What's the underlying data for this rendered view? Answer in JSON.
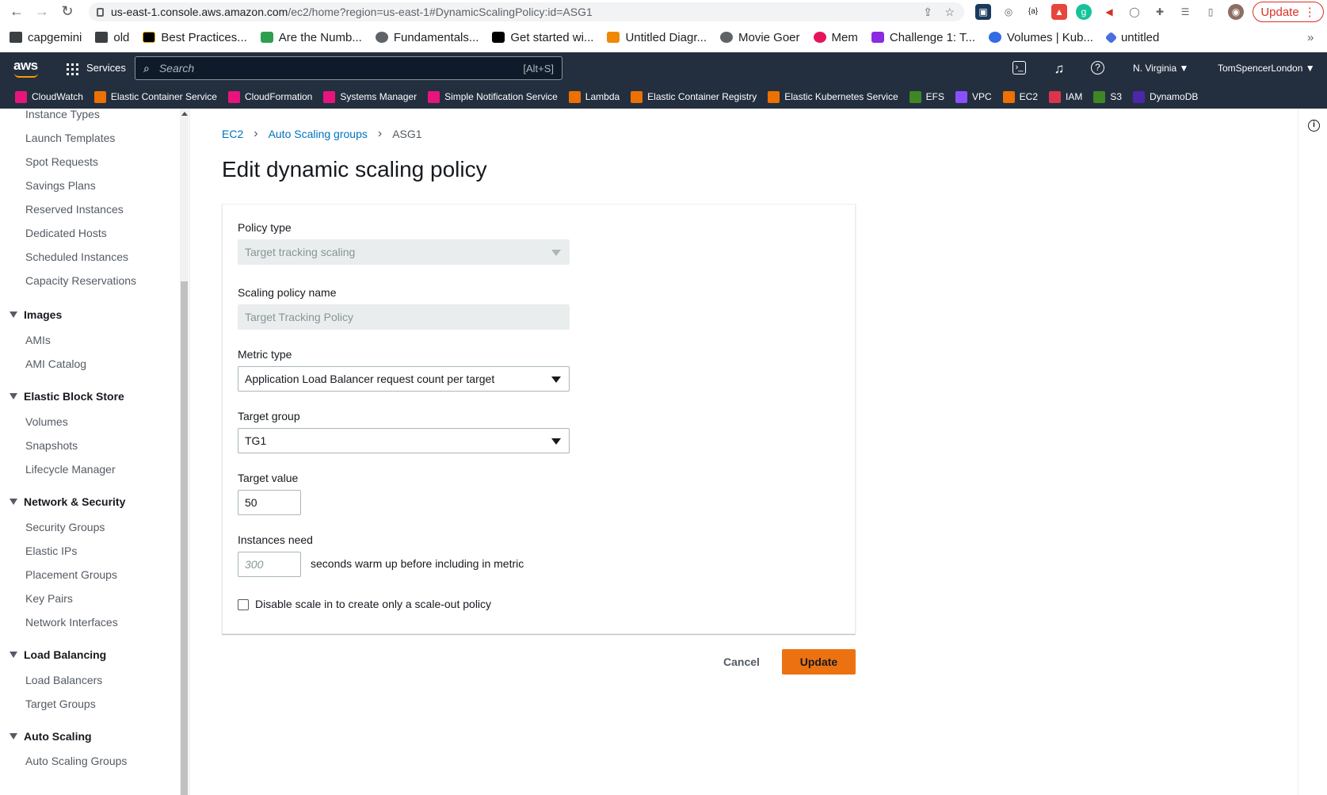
{
  "browser": {
    "url_host": "us-east-1.console.aws.amazon.com",
    "url_path": "/ec2/home?region=us-east-1#DynamicScalingPolicy:id=ASG1",
    "update_label": "Update"
  },
  "bookmarks": [
    "capgemini",
    "old",
    "Best Practices...",
    "Are the Numb...",
    "Fundamentals...",
    "Get started wi...",
    "Untitled Diagr...",
    "Movie Goer",
    "Mem",
    "Challenge 1: T...",
    "Volumes | Kub...",
    "untitled"
  ],
  "aws_nav": {
    "services_label": "Services",
    "search_placeholder": "Search",
    "search_shortcut": "[Alt+S]",
    "region": "N. Virginia",
    "user": "TomSpencerLondon"
  },
  "favorites": [
    "CloudWatch",
    "Elastic Container Service",
    "CloudFormation",
    "Systems Manager",
    "Simple Notification Service",
    "Lambda",
    "Elastic Container Registry",
    "Elastic Kubernetes Service",
    "EFS",
    "VPC",
    "EC2",
    "IAM",
    "S3",
    "DynamoDB"
  ],
  "sidebar": {
    "instances_items": [
      "Instance Types",
      "Launch Templates",
      "Spot Requests",
      "Savings Plans",
      "Reserved Instances",
      "Dedicated Hosts",
      "Scheduled Instances",
      "Capacity Reservations"
    ],
    "images_title": "Images",
    "images_items": [
      "AMIs",
      "AMI Catalog"
    ],
    "ebs_title": "Elastic Block Store",
    "ebs_items": [
      "Volumes",
      "Snapshots",
      "Lifecycle Manager"
    ],
    "network_title": "Network & Security",
    "network_items": [
      "Security Groups",
      "Elastic IPs",
      "Placement Groups",
      "Key Pairs",
      "Network Interfaces"
    ],
    "lb_title": "Load Balancing",
    "lb_items": [
      "Load Balancers",
      "Target Groups"
    ],
    "as_title": "Auto Scaling",
    "as_items": [
      "Auto Scaling Groups"
    ]
  },
  "breadcrumb": {
    "ec2": "EC2",
    "asg": "Auto Scaling groups",
    "current": "ASG1"
  },
  "page_title": "Edit dynamic scaling policy",
  "form": {
    "policy_type_label": "Policy type",
    "policy_type_value": "Target tracking scaling",
    "policy_name_label": "Scaling policy name",
    "policy_name_value": "Target Tracking Policy",
    "metric_type_label": "Metric type",
    "metric_type_value": "Application Load Balancer request count per target",
    "target_group_label": "Target group",
    "target_group_value": "TG1",
    "target_value_label": "Target value",
    "target_value": "50",
    "instances_need_label": "Instances need",
    "warmup_placeholder": "300",
    "warmup_suffix": "seconds warm up before including in metric",
    "disable_scale_in_label": "Disable scale in to create only a scale-out policy"
  },
  "actions": {
    "cancel": "Cancel",
    "update": "Update"
  },
  "colors": {
    "aws_nav": "#232f3e",
    "primary_button": "#ec7211",
    "link": "#0073bb"
  }
}
